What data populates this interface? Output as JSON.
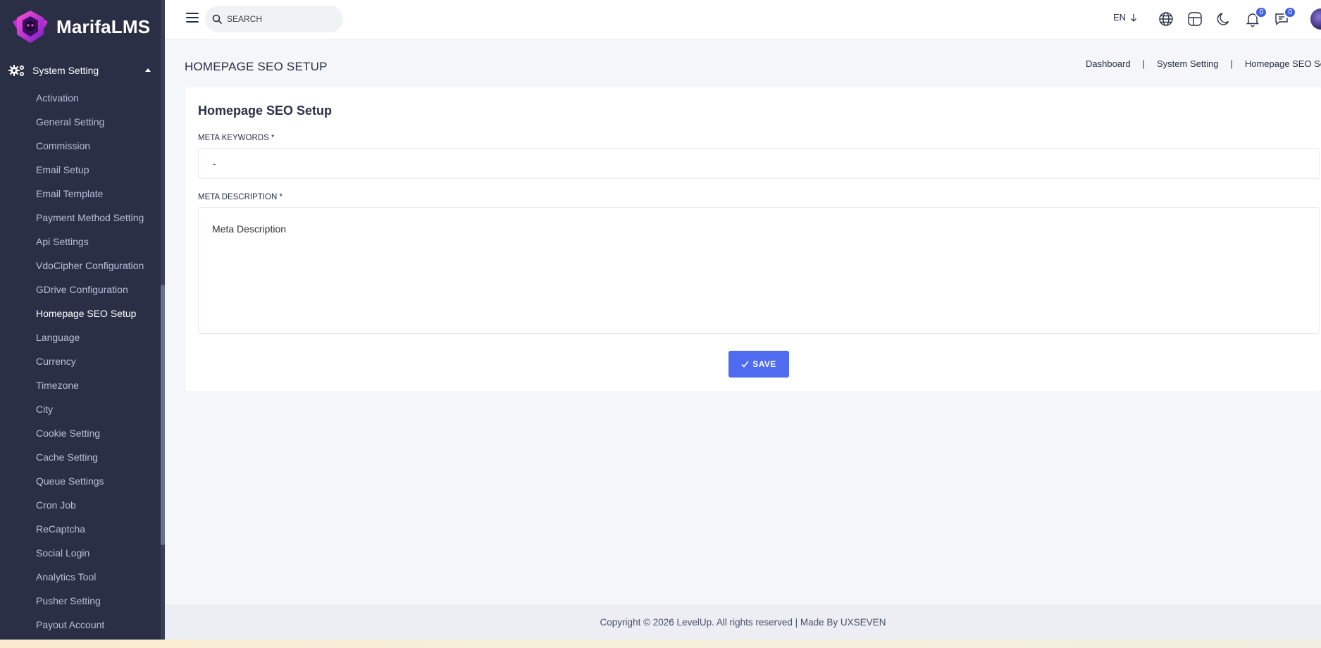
{
  "app": {
    "logo_text": "MarifaLMS"
  },
  "sidebar": {
    "section_label": "System Setting",
    "items": [
      {
        "label": "Activation",
        "active": false
      },
      {
        "label": "General Setting",
        "active": false
      },
      {
        "label": "Commission",
        "active": false
      },
      {
        "label": "Email Setup",
        "active": false
      },
      {
        "label": "Email Template",
        "active": false
      },
      {
        "label": "Payment Method Setting",
        "active": false
      },
      {
        "label": "Api Settings",
        "active": false
      },
      {
        "label": "VdoCipher Configuration",
        "active": false
      },
      {
        "label": "GDrive Configuration",
        "active": false
      },
      {
        "label": "Homepage SEO Setup",
        "active": true
      },
      {
        "label": "Language",
        "active": false
      },
      {
        "label": "Currency",
        "active": false
      },
      {
        "label": "Timezone",
        "active": false
      },
      {
        "label": "City",
        "active": false
      },
      {
        "label": "Cookie Setting",
        "active": false
      },
      {
        "label": "Cache Setting",
        "active": false
      },
      {
        "label": "Queue Settings",
        "active": false
      },
      {
        "label": "Cron Job",
        "active": false
      },
      {
        "label": "ReCaptcha",
        "active": false
      },
      {
        "label": "Social Login",
        "active": false
      },
      {
        "label": "Analytics Tool",
        "active": false
      },
      {
        "label": "Pusher Setting",
        "active": false
      },
      {
        "label": "Payout Account",
        "active": false
      }
    ]
  },
  "header": {
    "search_placeholder": "SEARCH",
    "language": "EN",
    "notifications_count": "0",
    "messages_count": "0"
  },
  "page": {
    "title": "HOMEPAGE SEO SETUP",
    "breadcrumb": [
      "Dashboard",
      "System Setting",
      "Homepage SEO Setup"
    ]
  },
  "form": {
    "card_title": "Homepage SEO Setup",
    "keywords_label": "META KEYWORDS *",
    "keywords_value": "-",
    "description_label": "META DESCRIPTION *",
    "description_value": "Meta Description",
    "save_label": "SAVE"
  },
  "footer": {
    "text": "Copyright © 2026 LevelUp. All rights reserved | Made By UXSEVEN"
  },
  "colors": {
    "sidebar_bg": "#2a2f46",
    "accent": "#4f6cf0",
    "page_bg": "#f5f6f9"
  }
}
